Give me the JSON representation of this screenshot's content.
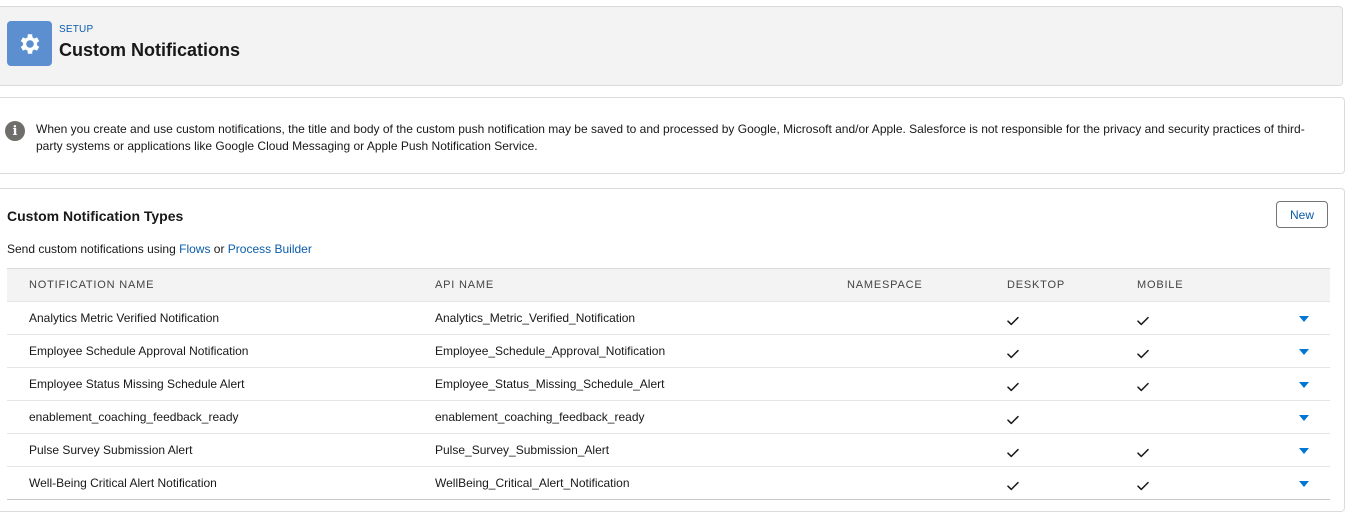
{
  "header": {
    "eyebrow": "SETUP",
    "title": "Custom Notifications",
    "icon": "gear-icon"
  },
  "notice": {
    "icon": "info-icon",
    "text": "When you create and use custom notifications, the title and body of the custom push notification may be saved to and processed by Google, Microsoft and/or Apple. Salesforce is not responsible for the privacy and security practices of third-party systems or applications like Google Cloud Messaging or Apple Push Notification Service."
  },
  "card": {
    "title": "Custom Notification Types",
    "new_label": "New",
    "desc_prefix": "Send custom notifications using ",
    "desc_link1": "Flows",
    "desc_middle": " or ",
    "desc_link2": "Process Builder"
  },
  "table": {
    "headers": [
      "NOTIFICATION NAME",
      "API NAME",
      "NAMESPACE",
      "DESKTOP",
      "MOBILE"
    ],
    "rows": [
      {
        "name": "Analytics Metric Verified Notification",
        "api": "Analytics_Metric_Verified_Notification",
        "namespace": "",
        "desktop": true,
        "mobile": true
      },
      {
        "name": "Employee Schedule Approval Notification",
        "api": "Employee_Schedule_Approval_Notification",
        "namespace": "",
        "desktop": true,
        "mobile": true
      },
      {
        "name": "Employee Status Missing Schedule Alert",
        "api": "Employee_Status_Missing_Schedule_Alert",
        "namespace": "",
        "desktop": true,
        "mobile": true
      },
      {
        "name": "enablement_coaching_feedback_ready",
        "api": "enablement_coaching_feedback_ready",
        "namespace": "",
        "desktop": true,
        "mobile": false
      },
      {
        "name": "Pulse Survey Submission Alert",
        "api": "Pulse_Survey_Submission_Alert",
        "namespace": "",
        "desktop": true,
        "mobile": true
      },
      {
        "name": "Well-Being Critical Alert Notification",
        "api": "WellBeing_Critical_Alert_Notification",
        "namespace": "",
        "desktop": true,
        "mobile": true
      }
    ]
  },
  "colors": {
    "brand_icon": "#5b8fcf",
    "link": "#0b5cab",
    "row_menu": "#0176d3"
  }
}
